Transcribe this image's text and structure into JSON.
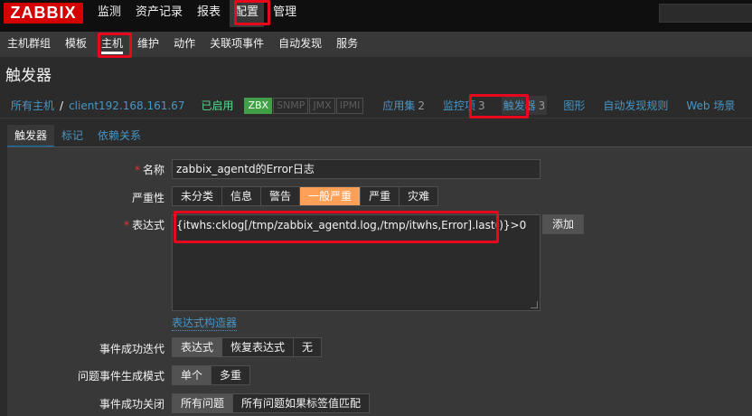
{
  "logo": "ZABBIX",
  "main_menu": [
    "监测",
    "资产记录",
    "报表",
    "配置",
    "管理"
  ],
  "sub_menu": [
    "主机群组",
    "模板",
    "主机",
    "维护",
    "动作",
    "关联项事件",
    "自动发现",
    "服务"
  ],
  "page_title": "触发器",
  "breadcrumb": {
    "all_hosts": "所有主机",
    "sep": "/",
    "host": "client192.168.161.67",
    "status": "已启用",
    "badges": [
      "ZBX",
      "SNMP",
      "JMX",
      "IPMI"
    ],
    "links": [
      {
        "label": "应用集",
        "count": "2"
      },
      {
        "label": "监控项",
        "count": "3"
      },
      {
        "label": "触发器",
        "count": "3"
      },
      {
        "label": "图形",
        "count": ""
      },
      {
        "label": "自动发现规则",
        "count": ""
      },
      {
        "label": "Web 场景",
        "count": ""
      }
    ]
  },
  "tabs": [
    "触发器",
    "标记",
    "依赖关系"
  ],
  "form": {
    "name_label": "名称",
    "name_value": "zabbix_agentd的Error日志",
    "severity_label": "严重性",
    "severity_options": [
      "未分类",
      "信息",
      "警告",
      "一般严重",
      "严重",
      "灾难"
    ],
    "expression_label": "表达式",
    "expression_value": "{itwhs:cklog[/tmp/zabbix_agentd.log,/tmp/itwhs,Error].last()}>0",
    "add_button": "添加",
    "expression_builder": "表达式构造器",
    "ok_event_label": "事件成功迭代",
    "ok_event_options": [
      "表达式",
      "恢复表达式",
      "无"
    ],
    "problem_mode_label": "问题事件生成模式",
    "problem_mode_options": [
      "单个",
      "多重"
    ],
    "ok_close_label": "事件成功关闭",
    "ok_close_options": [
      "所有问题",
      "所有问题如果标签值匹配"
    ]
  },
  "colors": {
    "highlight": "#e8081d",
    "link": "#4796c4",
    "enabled": "#59db8f",
    "severity_selected": "#ffa059"
  }
}
